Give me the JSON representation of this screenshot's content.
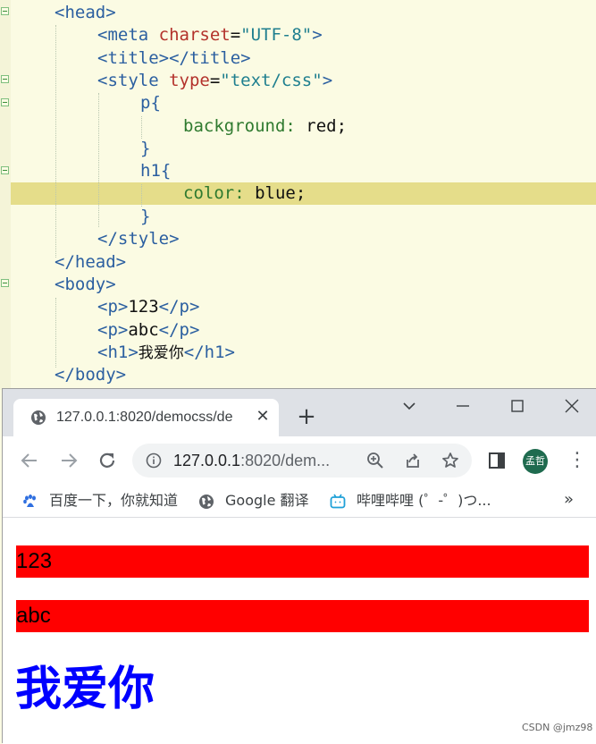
{
  "editor": {
    "lines": [
      {
        "head_open": "<head>"
      },
      {
        "meta_open": "<meta",
        "meta_attr": " charset",
        "meta_eq": "=",
        "meta_val": "\"UTF-8\"",
        "meta_close": ">"
      },
      {
        "title_tags": "<title></title>"
      },
      {
        "style_open": "<style",
        "style_attr": " type",
        "style_eq": "=",
        "style_val": "\"text/css\"",
        "style_close": ">"
      },
      {
        "p_sel": "p{"
      },
      {
        "bg_prop": "background",
        "bg_colon": ": ",
        "bg_val": "red;"
      },
      {
        "brace1": "}"
      },
      {
        "h1_sel": "h1{"
      },
      {
        "color_prop": "color",
        "color_colon": ": ",
        "color_val": "blue;"
      },
      {
        "brace2": "}"
      },
      {
        "style_end": "</style>"
      },
      {
        "head_end": "</head>"
      },
      {
        "body_open": "<body>"
      },
      {
        "p1_open": "<p>",
        "p1_text": "123",
        "p1_close": "</p>"
      },
      {
        "p2_open": "<p>",
        "p2_text": "abc",
        "p2_close": "</p>"
      },
      {
        "h1_open": "<h1>",
        "h1_text": "我爱你",
        "h1_close": "</h1>"
      },
      {
        "body_end": "</body>"
      }
    ]
  },
  "browser": {
    "tab_title": "127.0.0.1:8020/democss/de",
    "tab_close": "✕",
    "new_tab": "+",
    "url_host": "127.0.0.1",
    "url_rest": ":8020/dem...",
    "avatar_text": "孟哲",
    "menu": "⋮",
    "bookmarks": [
      {
        "label": "百度一下，你就知道",
        "icon": "baidu-paw-icon"
      },
      {
        "label": "Google 翻译",
        "icon": "globe-icon"
      },
      {
        "label": "哔哩哔哩 (゜-゜)つ...",
        "icon": "bilibili-tv-icon"
      }
    ],
    "bookmarks_more": "»"
  },
  "page": {
    "p1": "123",
    "p2": "abc",
    "h1": "我爱你",
    "p_background": "#ff0000",
    "h1_color": "#0000ff"
  },
  "watermark": "CSDN @jmz98"
}
